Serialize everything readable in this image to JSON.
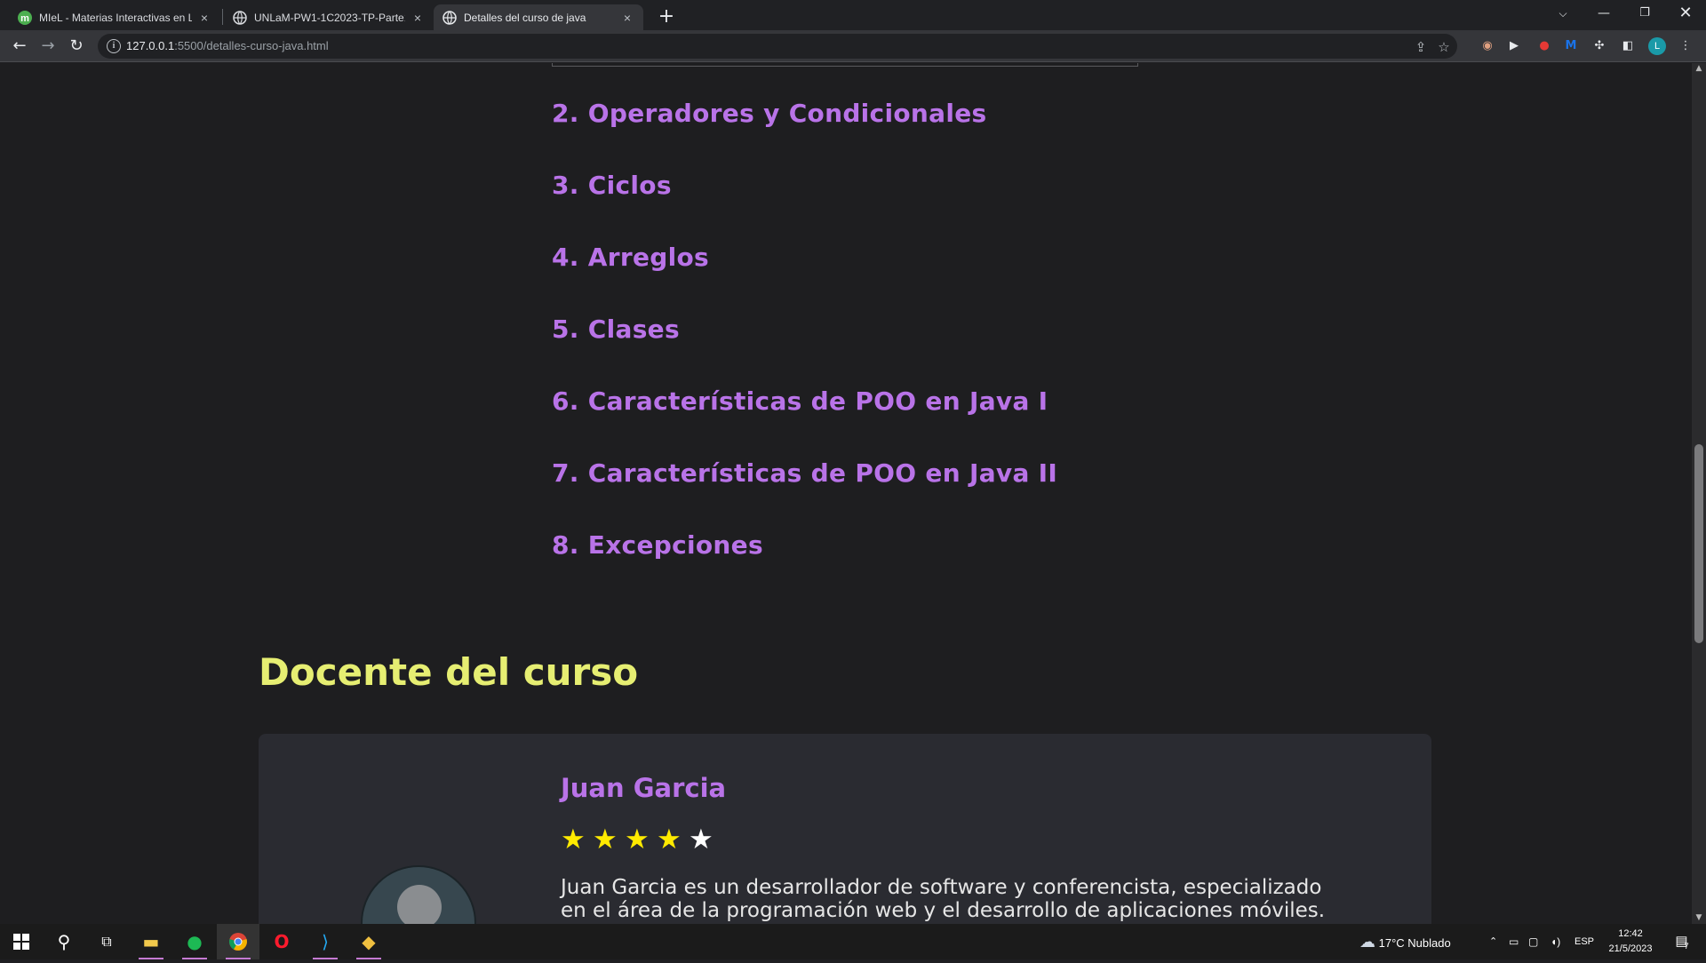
{
  "browser": {
    "tabs": [
      {
        "title": "MIeL - Materias Interactivas en Lí",
        "close": "×"
      },
      {
        "title": "UNLaM-PW1-1C2023-TP-Parte1.p",
        "close": "×"
      },
      {
        "title": "Detalles del curso de java",
        "close": "×"
      }
    ],
    "new_tab": "+",
    "url_host": "127.0.0.1",
    "url_rest": ":5500/detalles-curso-java.html",
    "profile_initial": "L"
  },
  "page": {
    "modules": [
      "2. Operadores y Condicionales",
      "3. Ciclos",
      "4. Arreglos",
      "5. Clases",
      "6. Características de POO en Java I",
      "7. Características de POO en Java II",
      "8. Excepciones"
    ],
    "teacher_section_title": "Docente del curso",
    "teacher": {
      "name": "Juan Garcia",
      "rating": 4,
      "rating_max": 5,
      "bio": "Juan Garcia es un desarrollador de software y conferencista, especializado en el área de la programación web y el desarrollo de aplicaciones móviles. Es"
    }
  },
  "taskbar": {
    "weather": "17°C  Nublado",
    "lang": "ESP",
    "time": "12:42",
    "date": "21/5/2023",
    "notifications": "7"
  },
  "colors": {
    "accent_purple": "#b973e8",
    "heading_yellow": "#e6ee72",
    "star_yellow": "#ffea00",
    "page_bg": "#1e1e20",
    "card_bg": "#2a2b31"
  }
}
